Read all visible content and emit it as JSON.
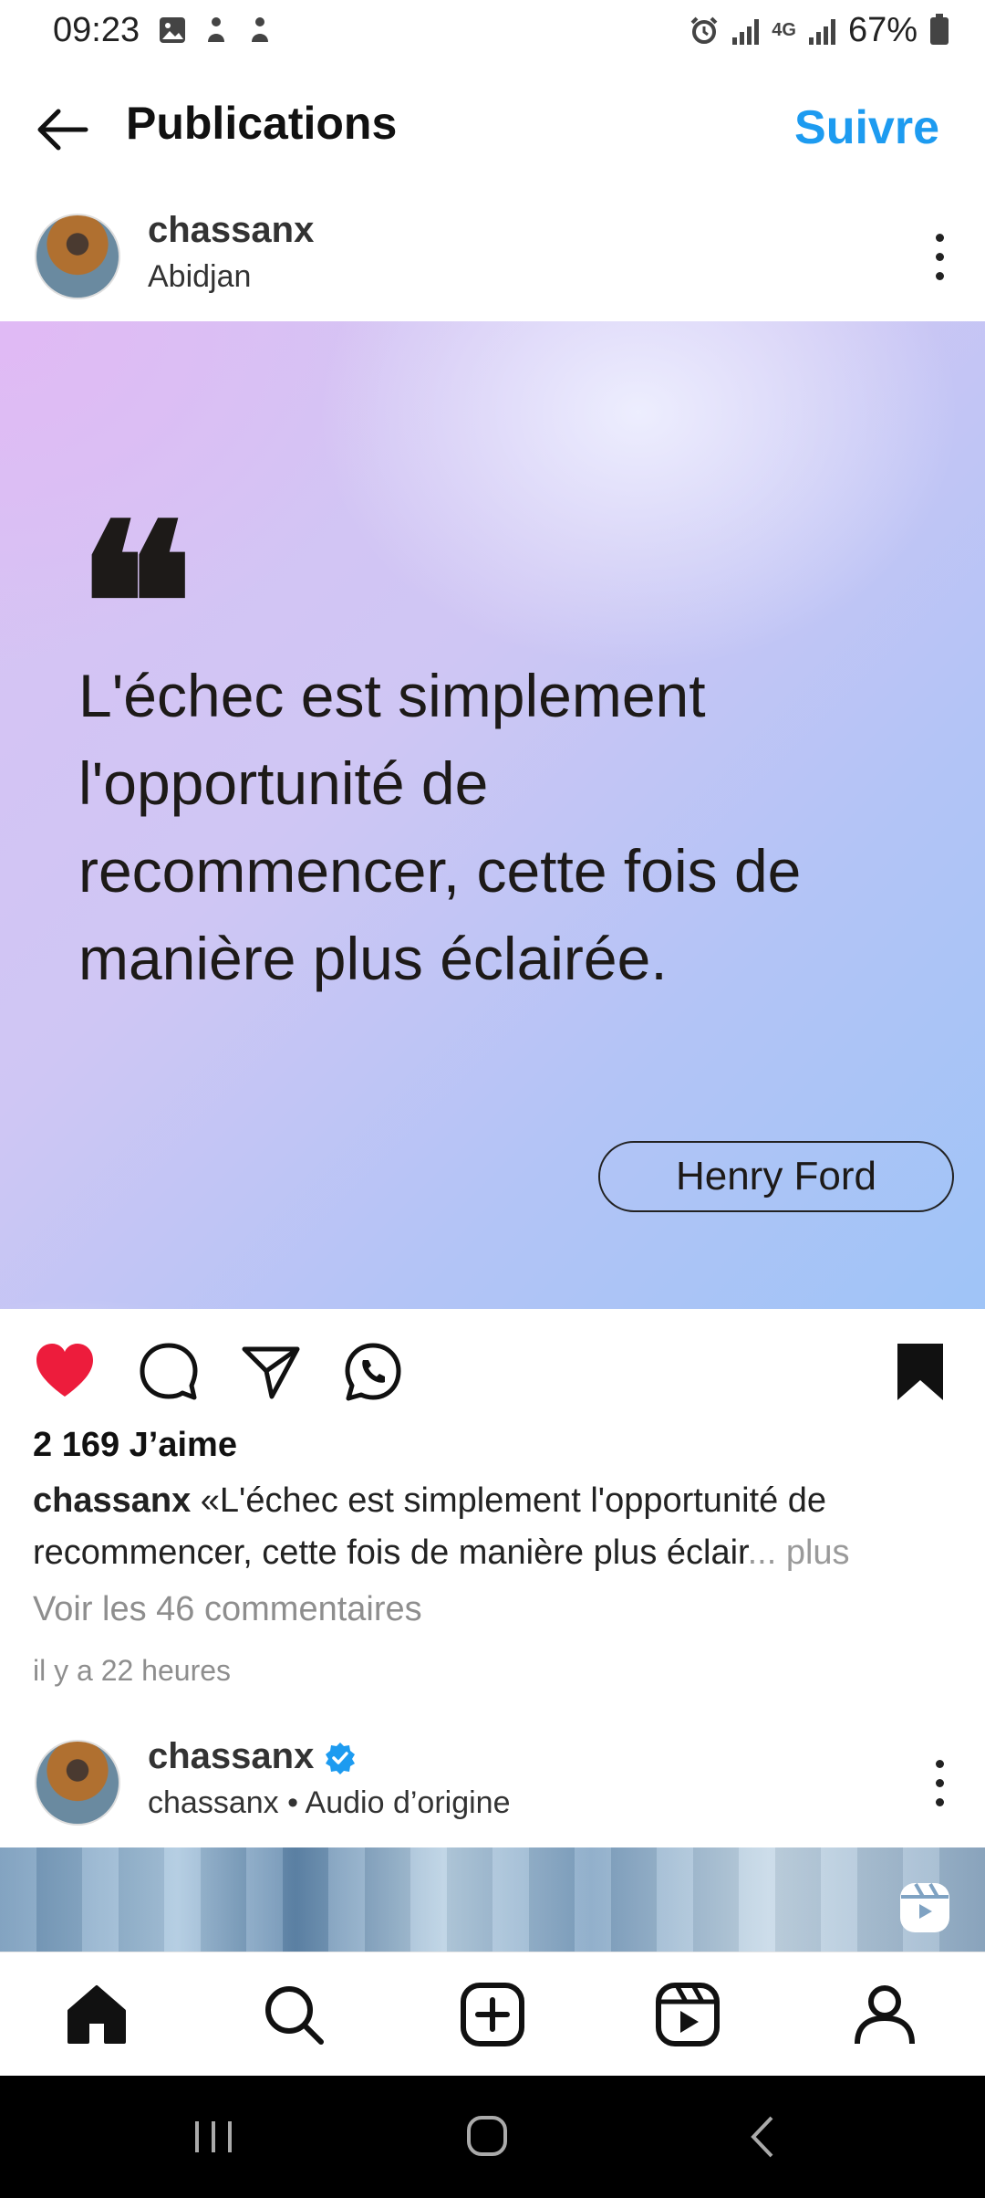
{
  "status_bar": {
    "time": "09:23",
    "network": "4G",
    "battery": "67%"
  },
  "header": {
    "title": "Publications",
    "follow_label": "Suivre"
  },
  "post": {
    "username": "chassanx",
    "location": "Abidjan",
    "image": {
      "quote": "L'échec est simplement l'opportunité de recommencer, cette fois de manière plus éclairée.",
      "author": "Henry Ford",
      "quote_mark": "❝"
    },
    "liked": true,
    "likes": "2 169 J’aime",
    "caption_user": "chassanx",
    "caption_text": " «L'échec est simplement l'opportunité de recommencer, cette fois de manière plus éclair",
    "caption_more": "... plus",
    "comments_link": "Voir les 46 commentaires",
    "time_ago": "il y a 22 heures"
  },
  "next_post": {
    "username": "chassanx",
    "audio": "chassanx • Audio d’origine",
    "verified": true
  },
  "colors": {
    "accent": "#1d9bf0",
    "like": "#ed1c3c"
  }
}
